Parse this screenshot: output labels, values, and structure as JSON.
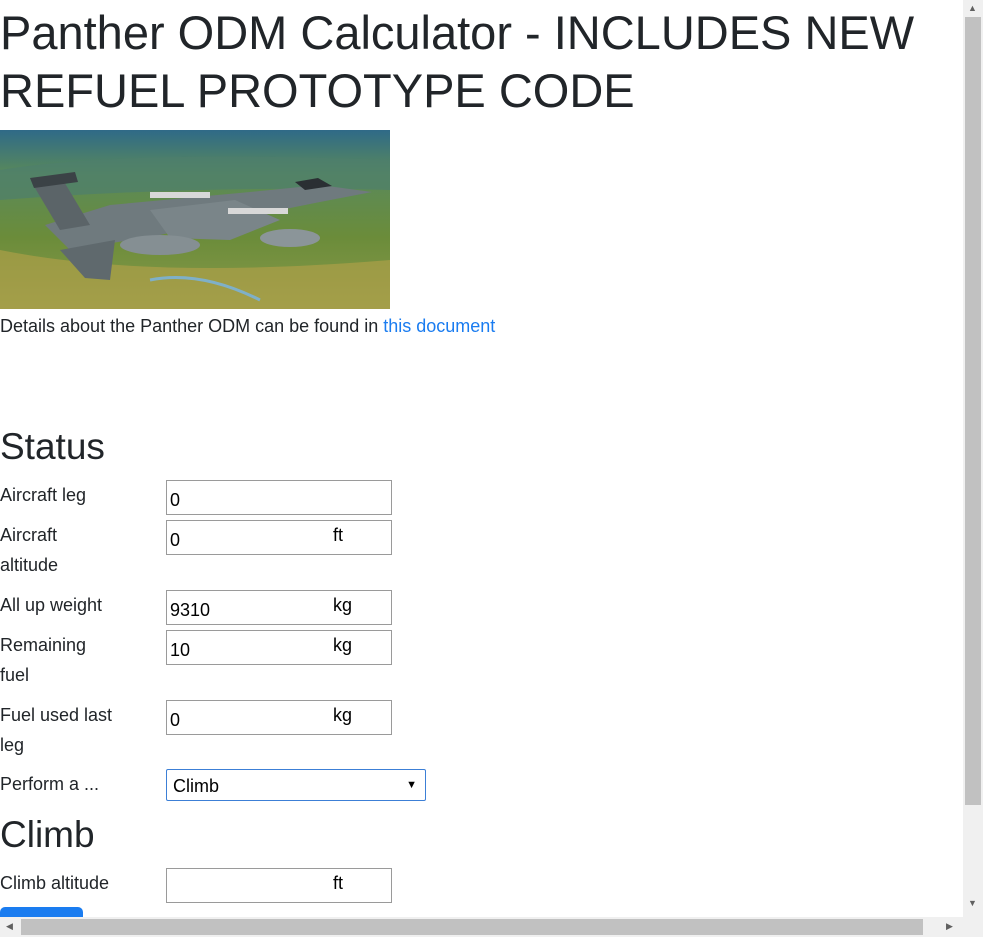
{
  "page": {
    "title": "Panther ODM Calculator - INCLUDES NEW REFUEL PROTOTYPE CODE",
    "details_text": "Details about the Panther ODM can be found in ",
    "details_link": "this document"
  },
  "status": {
    "heading": "Status",
    "fields": [
      {
        "label": "Aircraft leg",
        "value": "0",
        "unit": ""
      },
      {
        "label": "Aircraft altitude",
        "value": "0",
        "unit": "ft"
      },
      {
        "label": "All up weight",
        "value": "9310",
        "unit": "kg"
      },
      {
        "label": "Remaining fuel",
        "value": "10",
        "unit": "kg"
      },
      {
        "label": "Fuel used last leg",
        "value": "0",
        "unit": "kg"
      }
    ],
    "perform_label": "Perform a ...",
    "perform_value": "Climb"
  },
  "climb": {
    "heading": "Climb",
    "altitude_label": "Climb altitude",
    "altitude_value": "",
    "altitude_unit": "ft"
  },
  "colors": {
    "link": "#1a7cf0",
    "button": "#1a7cf0",
    "text": "#212529"
  }
}
